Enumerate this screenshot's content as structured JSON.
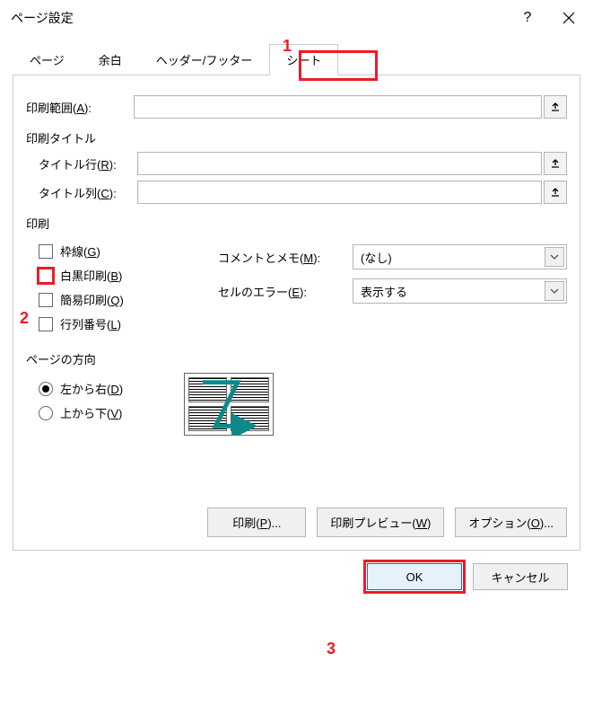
{
  "dialog": {
    "title": "ページ設定",
    "help_icon": "?",
    "close_icon": "×"
  },
  "tabs": {
    "page": "ページ",
    "margins": "余白",
    "header_footer": "ヘッダー/フッター",
    "sheet": "シート"
  },
  "annotations": {
    "n1": "1",
    "n2": "2",
    "n3": "3"
  },
  "sheet": {
    "print_area_label": "印刷範囲(",
    "print_area_key": "A",
    "print_area_suffix": "):",
    "print_area_value": "",
    "titles_group": "印刷タイトル",
    "title_rows_label": "タイトル行(",
    "title_rows_key": "R",
    "title_rows_suffix": "):",
    "title_rows_value": "",
    "title_cols_label": "タイトル列(",
    "title_cols_key": "C",
    "title_cols_suffix": "):",
    "title_cols_value": "",
    "print_group": "印刷",
    "chk_gridlines": "枠線(",
    "chk_gridlines_key": "G",
    "chk_gridlines_suffix": ")",
    "chk_bw": "白黒印刷(",
    "chk_bw_key": "B",
    "chk_bw_suffix": ")",
    "chk_draft": "簡易印刷(",
    "chk_draft_key": "Q",
    "chk_draft_suffix": ")",
    "chk_rowcol": "行列番号(",
    "chk_rowcol_key": "L",
    "chk_rowcol_suffix": ")",
    "comments_label": "コメントとメモ(",
    "comments_key": "M",
    "comments_suffix": "):",
    "comments_value": "(なし)",
    "errors_label": "セルのエラー(",
    "errors_key": "E",
    "errors_suffix": "):",
    "errors_value": "表示する",
    "order_group": "ページの方向",
    "order_ltr": "左から右(",
    "order_ltr_key": "D",
    "order_ltr_suffix": ")",
    "order_ttb": "上から下(",
    "order_ttb_key": "V",
    "order_ttb_suffix": ")"
  },
  "buttons": {
    "print": "印刷(",
    "print_key": "P",
    "print_suffix": ")...",
    "preview": "印刷プレビュー(",
    "preview_key": "W",
    "preview_suffix": ")",
    "options": "オプション(",
    "options_key": "O",
    "options_suffix": ")...",
    "ok": "OK",
    "cancel": "キャンセル"
  }
}
